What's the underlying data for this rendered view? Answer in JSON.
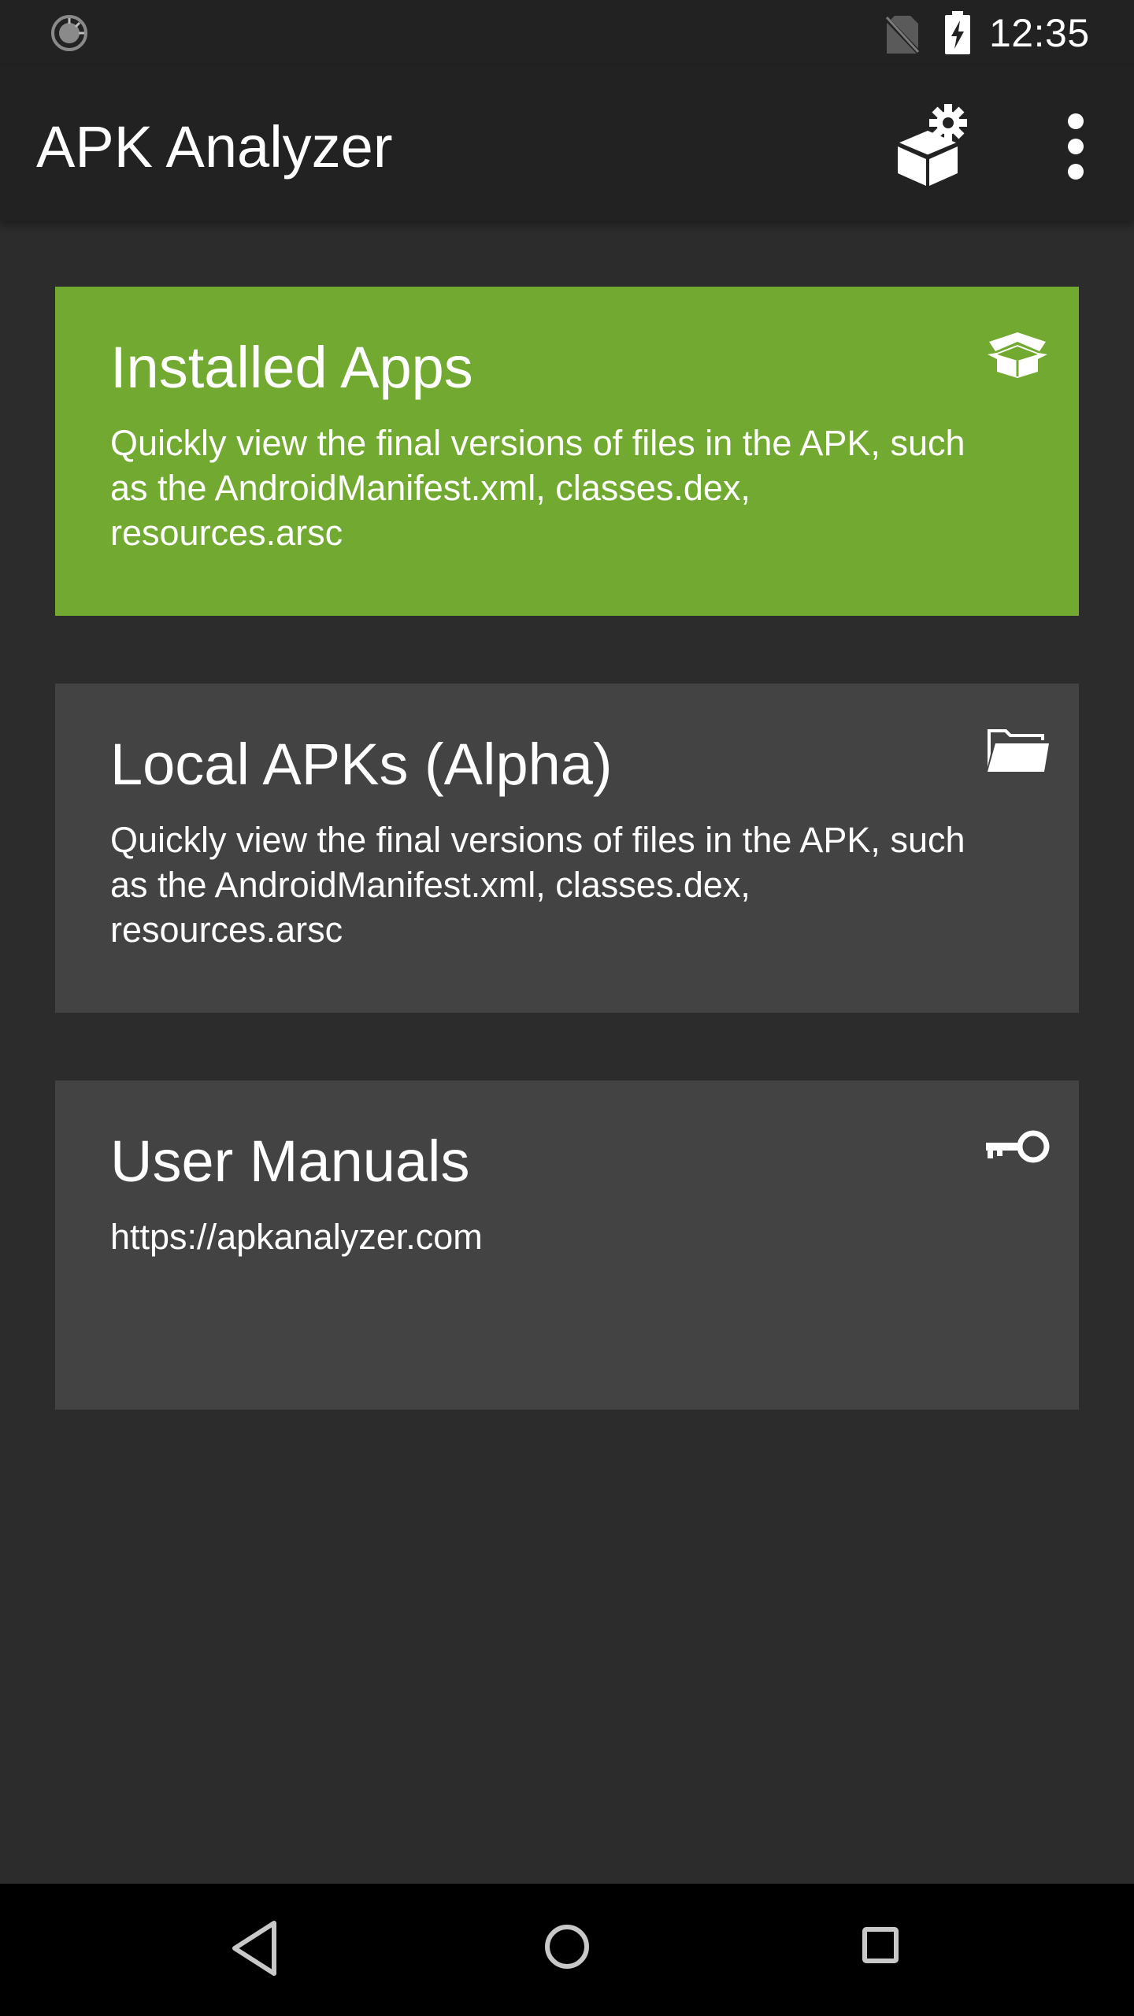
{
  "status_bar": {
    "time": "12:35"
  },
  "app_bar": {
    "title": "APK Analyzer",
    "actions": [
      "settings-box-icon",
      "overflow-menu-icon"
    ]
  },
  "cards": [
    {
      "title": "Installed Apps",
      "description": "Quickly view the final versions of files in the APK, such as the AndroidManifest.xml, classes.dex, resources.arsc",
      "icon": "box-open-icon",
      "color": "#72aa31"
    },
    {
      "title": "Local APKs (Alpha)",
      "description": "Quickly view the final versions of files in the APK, such as the AndroidManifest.xml, classes.dex, resources.arsc",
      "icon": "folder-open-icon",
      "color": "#434343"
    },
    {
      "title": "User Manuals",
      "description": "https://apkanalyzer.com",
      "icon": "key-icon",
      "color": "#434343"
    }
  ],
  "nav_bar": {
    "buttons": [
      "back-icon",
      "home-icon",
      "recents-icon"
    ]
  }
}
